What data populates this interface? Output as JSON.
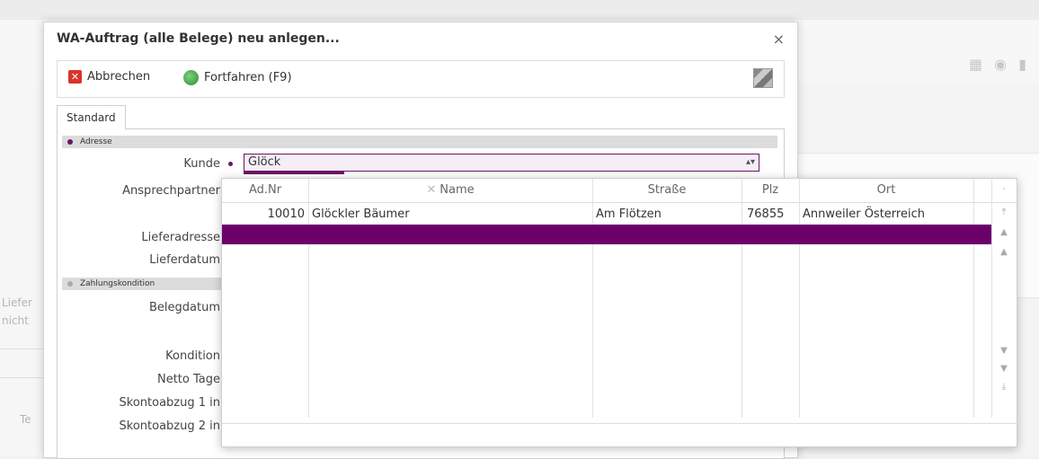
{
  "dialog": {
    "title": "WA-Auftrag (alle Belege) neu anlegen...",
    "close_label": "×"
  },
  "toolbar": {
    "cancel_label": "Abbrechen",
    "continue_label": "Fortfahren (F9)"
  },
  "tabs": [
    {
      "label": "Standard"
    }
  ],
  "sections": {
    "address": "Adresse",
    "payment": "Zahlungskondition"
  },
  "fields": {
    "kunde_label": "Kunde",
    "kunde_value": "Glöck",
    "ansprechpartner_label": "Ansprechpartner",
    "lieferadresse_label": "Lieferadresse",
    "lieferdatum_label": "Lieferdatum",
    "belegdatum_label": "Belegdatum",
    "kondition_label": "Kondition",
    "netto_tage_label": "Netto Tage",
    "skonto1_label": "Skontoabzug 1 in",
    "skonto2_label": "Skontoabzug 2 in"
  },
  "grid": {
    "columns": [
      "Ad.Nr",
      "Name",
      "Straße",
      "Plz",
      "Ort"
    ],
    "rows": [
      {
        "adnr": "10010",
        "name": "Glöckler Bäumer",
        "strasse": "Am Flötzen",
        "plz": "76855",
        "ort": "Annweiler Österreich"
      }
    ],
    "header_extra": "·"
  },
  "background": {
    "left_texts": [
      "Liefer",
      "nicht",
      "Te"
    ]
  },
  "colors": {
    "accent": "#6b006b",
    "cancel": "#d9342b"
  }
}
